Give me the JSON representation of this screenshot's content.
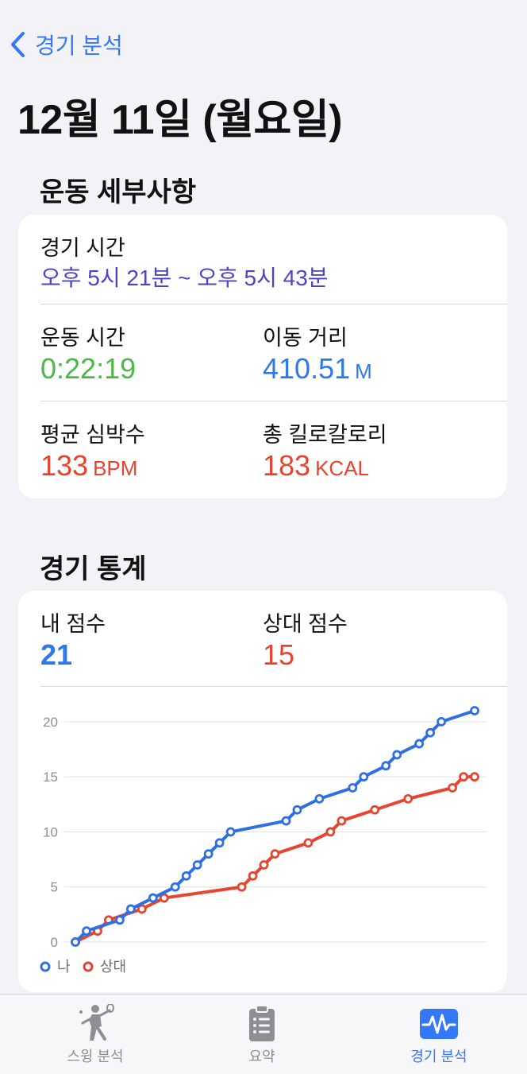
{
  "nav": {
    "back_label": "경기 분석"
  },
  "page_title": "12월 11일 (월요일)",
  "details": {
    "section_title": "운동 세부사항",
    "game_time": {
      "label": "경기 시간",
      "value": "오후 5시 21분 ~ 오후 5시 43분",
      "color": "#4b44c8"
    },
    "workout_time": {
      "label": "운동 시간",
      "value": "0:22:19",
      "color": "#4cb84a"
    },
    "distance": {
      "label": "이동 거리",
      "value": "410.51",
      "unit": "M",
      "color": "#2f78e8"
    },
    "avg_hr": {
      "label": "평균 심박수",
      "value": "133",
      "unit": "BPM",
      "color": "#e8432f"
    },
    "calories": {
      "label": "총 킬로칼로리",
      "value": "183",
      "unit": "KCAL",
      "color": "#e8432f"
    }
  },
  "stats": {
    "section_title": "경기 통계",
    "my_score": {
      "label": "내 점수",
      "value": "21",
      "color": "#2f78e8"
    },
    "opp_score": {
      "label": "상대 점수",
      "value": "15",
      "color": "#e8432f"
    }
  },
  "chart_data": {
    "type": "line",
    "yticks": [
      0,
      5,
      10,
      15,
      20
    ],
    "ylim": [
      0,
      21
    ],
    "grid": true,
    "legend_position": "bottom-left",
    "series": [
      {
        "name": "나",
        "color": "#2f6fe6",
        "points": [
          [
            0,
            0
          ],
          [
            1,
            1
          ],
          [
            4,
            2
          ],
          [
            5,
            3
          ],
          [
            7,
            4
          ],
          [
            9,
            5
          ],
          [
            10,
            6
          ],
          [
            11,
            7
          ],
          [
            12,
            8
          ],
          [
            13,
            9
          ],
          [
            14,
            10
          ],
          [
            19,
            11
          ],
          [
            20,
            12
          ],
          [
            22,
            13
          ],
          [
            25,
            14
          ],
          [
            26,
            15
          ],
          [
            28,
            16
          ],
          [
            29,
            17
          ],
          [
            31,
            18
          ],
          [
            32,
            19
          ],
          [
            33,
            20
          ],
          [
            36,
            21
          ]
        ]
      },
      {
        "name": "상대",
        "color": "#e84430",
        "points": [
          [
            0,
            0
          ],
          [
            2,
            1
          ],
          [
            3,
            2
          ],
          [
            6,
            3
          ],
          [
            8,
            4
          ],
          [
            15,
            5
          ],
          [
            16,
            6
          ],
          [
            17,
            7
          ],
          [
            18,
            8
          ],
          [
            21,
            9
          ],
          [
            23,
            10
          ],
          [
            24,
            11
          ],
          [
            27,
            12
          ],
          [
            30,
            13
          ],
          [
            34,
            14
          ],
          [
            35,
            15
          ],
          [
            36,
            15
          ]
        ]
      }
    ]
  },
  "tabbar": {
    "tabs": [
      {
        "label": "스윙 분석",
        "icon": "badminton-player-icon"
      },
      {
        "label": "요약",
        "icon": "clipboard-icon"
      },
      {
        "label": "경기 분석",
        "icon": "activity-icon",
        "active": true
      }
    ]
  }
}
